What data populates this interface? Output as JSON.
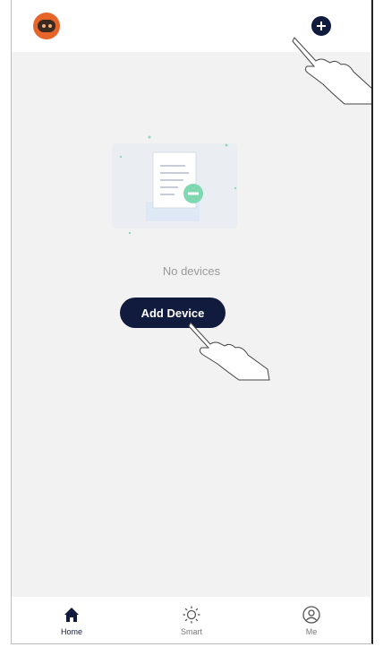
{
  "header": {
    "logo_icon": "robot-logo-icon",
    "add_icon": "plus-circle-icon"
  },
  "empty_state": {
    "illustration_icon": "document-minus-icon",
    "message": "No devices",
    "button_label": "Add Device"
  },
  "tabs": [
    {
      "label": "Home",
      "icon": "home-icon",
      "active": true
    },
    {
      "label": "Smart",
      "icon": "sun-icon",
      "active": false
    },
    {
      "label": "Me",
      "icon": "user-circle-icon",
      "active": false
    }
  ],
  "colors": {
    "primary": "#111b3e",
    "background": "#f2f2f2",
    "logo_orange": "#e8652a",
    "accent_green": "#6fd3a8"
  }
}
